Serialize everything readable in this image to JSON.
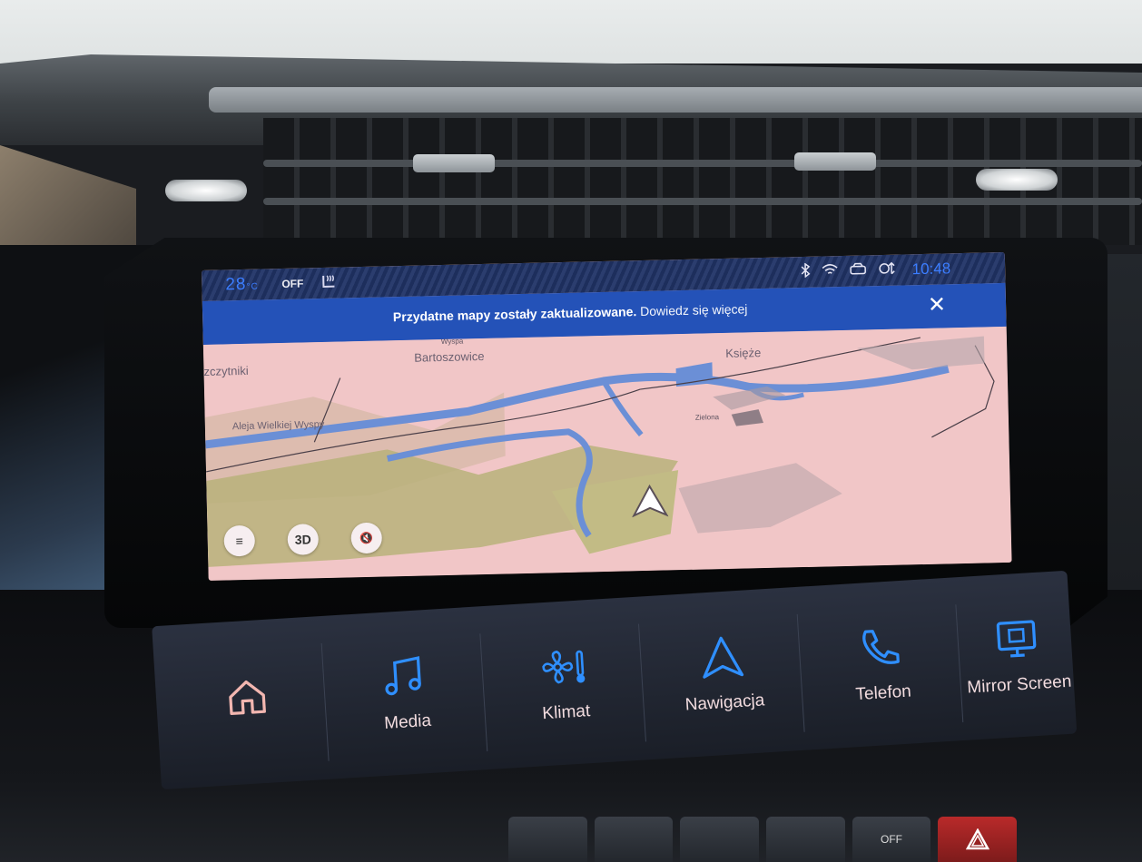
{
  "status_bar": {
    "temperature": "28",
    "temperature_unit": "°C",
    "climate_state": "OFF",
    "clock": "10:48",
    "icons": [
      "seat-heat-icon",
      "bluetooth-icon",
      "wifi-icon",
      "4g-car-icon",
      "car-sync-icon"
    ]
  },
  "notification": {
    "message": "Przydatne mapy zostały zaktualizowane.",
    "link": "Dowiedz się więcej",
    "close_label": "✕"
  },
  "map": {
    "labels": {
      "place1": "zczytniki",
      "place2": "Bartoszowice",
      "place3": "Księże",
      "place4": "Aleja Wielkiej Wyspy",
      "place5": "Zielona",
      "place6": "Wyspa"
    },
    "controls": {
      "menu_label": "≡",
      "view3d_label": "3D",
      "mute_label": "🔇"
    }
  },
  "touch_bar": {
    "items": [
      {
        "label": "",
        "icon": "home-icon"
      },
      {
        "label": "Media",
        "icon": "music-note-icon"
      },
      {
        "label": "Klimat",
        "icon": "fan-thermometer-icon"
      },
      {
        "label": "Nawigacja",
        "icon": "navigation-arrow-icon"
      },
      {
        "label": "Telefon",
        "icon": "phone-icon"
      },
      {
        "label": "Mirror Screen",
        "icon": "mirror-screen-icon"
      }
    ]
  },
  "hardware_buttons": [
    "",
    "",
    "",
    "",
    "OFF",
    ""
  ],
  "colors": {
    "accent_blue": "#3b7dff",
    "notification_bg": "#2452b8",
    "map_land": "#f1c6c7",
    "map_water": "#6b8fd6",
    "map_green": "#b9b27a",
    "hazard_red": "#b92a2a"
  }
}
